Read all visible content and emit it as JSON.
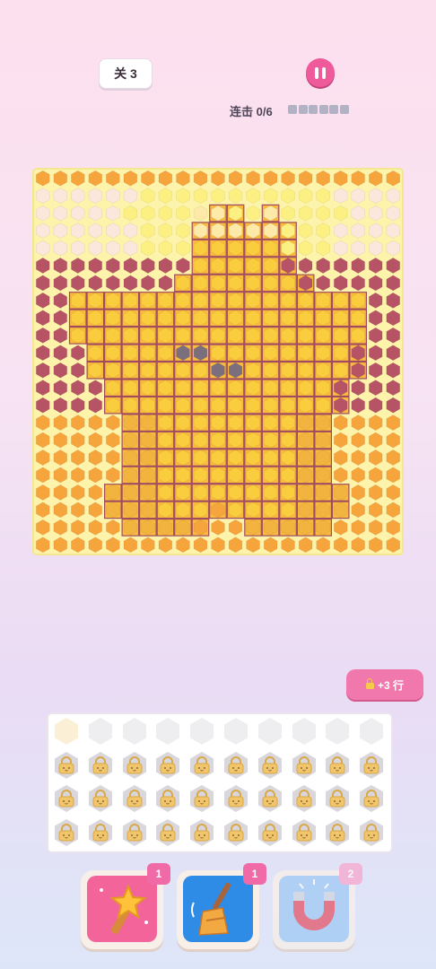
{
  "header": {
    "level_label": "关 3",
    "combo_label": "连击 0/6",
    "combo_total": 6,
    "combo_filled": 0
  },
  "board": {
    "cols": 21,
    "rows": 22,
    "palette": {
      "O": "#f6a43c",
      "W": "#fbe7dc",
      "P": "#fbf081",
      "L": "#fde9a8",
      "R": "#b65365",
      "Y": "#f9cd3d",
      "A": "#f2b43f",
      "G": "#7b6f7d",
      "B": "#f3e9b4",
      "frame": "#9f4c5f",
      "outline": "#f9ba3e"
    },
    "grid": [
      "OOOOOOOOOOOOOOOOOOOOO",
      "WWWWWWPPPPPPPPPPPWWWW",
      "WWWWWPPPPLLPPLPPPPWWW",
      "WWWWWWPPPLLLLLPPPWWWW",
      "WWWWWWPPPYYYYYPPPWWWW",
      "RRRRRRRRRYYYYYRRRRRRR",
      "RRRRRRRRYYYYYYYRRRRRR",
      "RRYYYYYYYYYYYYYYYYYRR",
      "RRYYYYYYYYYYYYYYYYYRR",
      "RRYYYYYYYYYYYYYYYYYRR",
      "RRRYYYYYYYYYYYYYYYRRR",
      "RRRYYYYYYYYYYYYYYYRRR",
      "RRRRYYYYYYYYYYYYYRRRR",
      "RRRRYYYYYYYYYYYYYRRRR",
      "OOOOOAAYYYYYYYYAAOOOO",
      "OOOOOAAYYYYYYYYAAOOOO",
      "OOOOOAAYYYYYYYYAAOOOO",
      "OOOOOAAYYYYYYYYAAOOOO",
      "OOOOAAAYYYYYYYYAAAOOO",
      "OOOOAAAYYYOYYYYAAAOOO",
      "OOOOOAAAAOOOAAAAAOOOO",
      "OOOOOOOOOOOOOOOOOOOOO"
    ],
    "framed": [
      "0000000000000000000000",
      "0000000000000000000000",
      "0000000000110100000000",
      "0000000001111110000000",
      "0000000001111110000000",
      "0000000001111110000000",
      "0000000011111111000000",
      "0011111111111111111000",
      "0011111111111111111000",
      "0011111111111111111000",
      "0001111111111111111000",
      "0001111111111111111000",
      "0000111111111111110000",
      "0000111111111111110000",
      "0000011111111111100000",
      "0000011111111111100000",
      "0000011111111111100000",
      "0000011111111111100000",
      "0000111111111111110000",
      "0000111111111111110000",
      "0000011111001111100000",
      "0000000000000000000000"
    ],
    "gray_cells": [
      [
        10,
        9
      ],
      [
        10,
        8
      ],
      [
        11,
        10
      ],
      [
        11,
        11
      ]
    ],
    "beige_cells": [
      [
        10,
        8
      ],
      [
        10,
        12
      ]
    ]
  },
  "unlock_button": {
    "label": "+3 行",
    "icon": "lock-icon"
  },
  "tray": {
    "cols": 10,
    "empty_rows": 1,
    "locked_rows": 3,
    "icon": "padlock-icon"
  },
  "boosters": [
    {
      "name": "magic-wand",
      "count": "1",
      "icon": "star-wand-icon",
      "face_color": "#f3649a",
      "badge_color": "#f06aa8",
      "enabled": true
    },
    {
      "name": "broom",
      "count": "1",
      "icon": "broom-icon",
      "face_color": "#2f8ce6",
      "badge_color": "#f06aa8",
      "enabled": true
    },
    {
      "name": "magnet",
      "count": "2",
      "icon": "magnet-icon",
      "face_color": "#9fc9f3",
      "badge_color": "#f7a8cd",
      "enabled": false
    }
  ]
}
